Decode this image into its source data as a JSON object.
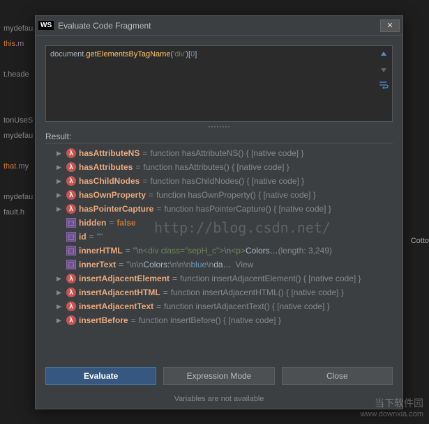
{
  "dialog": {
    "badge": "WS",
    "title": "Evaluate Code Fragment",
    "code_prefix": "document.",
    "code_fn": "getElementsByTagName",
    "code_arg": "'div'",
    "code_idx": "0",
    "result_label": "Result:",
    "evaluate": "Evaluate",
    "expression_mode": "Expression Mode",
    "close": "Close",
    "status": "Variables are not available"
  },
  "rows": [
    {
      "type": "fn",
      "name": "hasAttributeNS",
      "val": "function hasAttributeNS() { [native code] }"
    },
    {
      "type": "fn",
      "name": "hasAttributes",
      "val": "function hasAttributes() { [native code] }"
    },
    {
      "type": "fn",
      "name": "hasChildNodes",
      "val": "function hasChildNodes() { [native code] }"
    },
    {
      "type": "fn",
      "name": "hasOwnProperty",
      "val": "function hasOwnProperty() { [native code] }"
    },
    {
      "type": "fn",
      "name": "hasPointerCapture",
      "val": "function hasPointerCapture() { [native code] }"
    },
    {
      "type": "var",
      "name": "hidden",
      "val": "false",
      "special": "bool"
    },
    {
      "type": "var",
      "name": "id",
      "val": "\"\""
    },
    {
      "type": "var",
      "name": "innerHTML",
      "special": "html",
      "parts": [
        "\"\\n",
        "    <div class=\"sepH_c\">",
        "\\n",
        "        <p>",
        "Colors…"
      ],
      "suffix": "(length: 3,249)"
    },
    {
      "type": "var",
      "name": "innerText",
      "special": "text",
      "parts": [
        "\"\\n",
        "    \\n",
        "        Colors:",
        "\\n\\n",
        "            \\n",
        "                blue",
        "\\n",
        "                da…"
      ],
      "view": "View"
    },
    {
      "type": "fn",
      "name": "insertAdjacentElement",
      "val": "function insertAdjacentElement() { [native code] }"
    },
    {
      "type": "fn",
      "name": "insertAdjacentHTML",
      "val": "function insertAdjacentHTML() { [native code] }"
    },
    {
      "type": "fn",
      "name": "insertAdjacentText",
      "val": "function insertAdjacentText() { [native code] }"
    },
    {
      "type": "fn",
      "name": "insertBefore",
      "val": "function insertBefore() { [native code] }"
    }
  ],
  "bg": {
    "l1": "mydefau",
    "l2a": "this",
    "l2b": ".m",
    "l3": "t.heade",
    "l4": "tonUseS",
    "l5": "mydefau",
    "l6a": "that",
    "l6b": ".my",
    "l7": "mydefau",
    "l8": "fault.h",
    "r1": "Cotto"
  },
  "watermark": "http://blog.csdn.net/",
  "corner": {
    "l1": "当下软件园",
    "l2": "www.downxia.com"
  }
}
